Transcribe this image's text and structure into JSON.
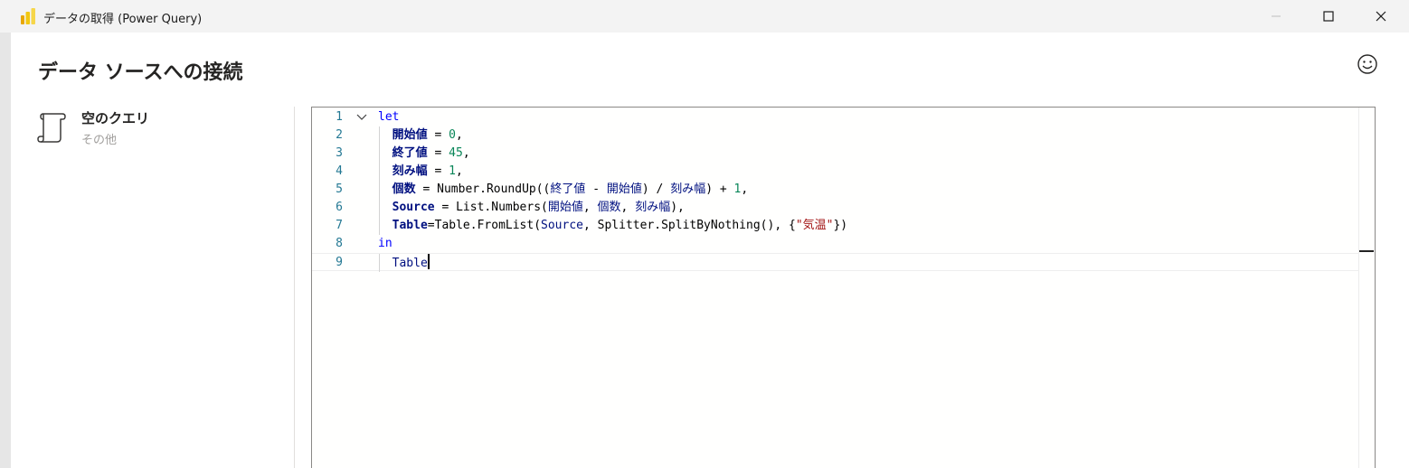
{
  "window": {
    "title": "データの取得 (Power Query)"
  },
  "dialog": {
    "heading": "データ ソースへの接続"
  },
  "query": {
    "name": "空のクエリ",
    "category": "その他",
    "icon": "scroll-icon"
  },
  "editor": {
    "current_line": 9,
    "lines": [
      {
        "n": "1",
        "tokens": [
          {
            "t": "let",
            "c": "kw"
          }
        ]
      },
      {
        "n": "2",
        "tokens": [
          {
            "t": "  ",
            "c": "pu"
          },
          {
            "t": "開始値",
            "c": "id"
          },
          {
            "t": " = ",
            "c": "pu"
          },
          {
            "t": "0",
            "c": "num"
          },
          {
            "t": ",",
            "c": "pu"
          }
        ]
      },
      {
        "n": "3",
        "tokens": [
          {
            "t": "  ",
            "c": "pu"
          },
          {
            "t": "終了値",
            "c": "id"
          },
          {
            "t": " = ",
            "c": "pu"
          },
          {
            "t": "45",
            "c": "num"
          },
          {
            "t": ",",
            "c": "pu"
          }
        ]
      },
      {
        "n": "4",
        "tokens": [
          {
            "t": "  ",
            "c": "pu"
          },
          {
            "t": "刻み幅",
            "c": "id"
          },
          {
            "t": " = ",
            "c": "pu"
          },
          {
            "t": "1",
            "c": "num"
          },
          {
            "t": ",",
            "c": "pu"
          }
        ]
      },
      {
        "n": "5",
        "tokens": [
          {
            "t": "  ",
            "c": "pu"
          },
          {
            "t": "個数",
            "c": "id"
          },
          {
            "t": " = ",
            "c": "pu"
          },
          {
            "t": "Number.RoundUp((",
            "c": "fn"
          },
          {
            "t": "終了値",
            "c": "ref"
          },
          {
            "t": " - ",
            "c": "pu"
          },
          {
            "t": "開始値",
            "c": "ref"
          },
          {
            "t": ") / ",
            "c": "pu"
          },
          {
            "t": "刻み幅",
            "c": "ref"
          },
          {
            "t": ") + ",
            "c": "pu"
          },
          {
            "t": "1",
            "c": "num"
          },
          {
            "t": ",",
            "c": "pu"
          }
        ]
      },
      {
        "n": "6",
        "tokens": [
          {
            "t": "  ",
            "c": "pu"
          },
          {
            "t": "Source",
            "c": "id"
          },
          {
            "t": " = ",
            "c": "pu"
          },
          {
            "t": "List.Numbers(",
            "c": "fn"
          },
          {
            "t": "開始値",
            "c": "ref"
          },
          {
            "t": ", ",
            "c": "pu"
          },
          {
            "t": "個数",
            "c": "ref"
          },
          {
            "t": ", ",
            "c": "pu"
          },
          {
            "t": "刻み幅",
            "c": "ref"
          },
          {
            "t": "),",
            "c": "pu"
          }
        ]
      },
      {
        "n": "7",
        "tokens": [
          {
            "t": "  ",
            "c": "pu"
          },
          {
            "t": "Table",
            "c": "id"
          },
          {
            "t": "=",
            "c": "pu"
          },
          {
            "t": "Table.FromList(",
            "c": "fn"
          },
          {
            "t": "Source",
            "c": "ref"
          },
          {
            "t": ", Splitter.SplitByNothing(), {",
            "c": "fn"
          },
          {
            "t": "\"気温\"",
            "c": "str"
          },
          {
            "t": "})",
            "c": "pu"
          }
        ]
      },
      {
        "n": "8",
        "tokens": [
          {
            "t": "in",
            "c": "kw"
          }
        ]
      },
      {
        "n": "9",
        "tokens": [
          {
            "t": "  ",
            "c": "pu"
          },
          {
            "t": "Table",
            "c": "ref"
          }
        ]
      }
    ]
  }
}
